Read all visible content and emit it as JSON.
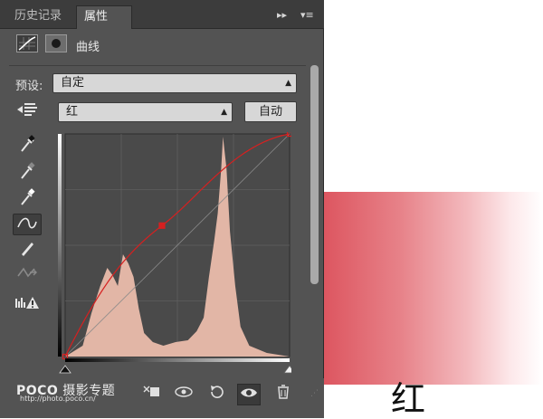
{
  "tabs": [
    {
      "label": "历史记录",
      "active": false
    },
    {
      "label": "属性",
      "active": true
    }
  ],
  "tab_controls": {
    "collapse": "▸▸",
    "menu": "▾≡"
  },
  "header": {
    "title": "曲线",
    "curve_icon": "curves-adjustment-icon",
    "mask_icon": "mask-icon"
  },
  "preset": {
    "label": "预设:",
    "value": "自定"
  },
  "channel": {
    "value": "红",
    "auto_label": "自动"
  },
  "left_tools": [
    {
      "name": "targeted-adjustment-icon",
      "glyph": "☚"
    },
    {
      "name": "black-eyedropper-icon",
      "glyph": "⁄"
    },
    {
      "name": "gray-eyedropper-icon",
      "glyph": "⁄"
    },
    {
      "name": "white-eyedropper-icon",
      "glyph": "⁄"
    },
    {
      "name": "curve-point-icon",
      "glyph": "∿"
    },
    {
      "name": "pencil-icon",
      "glyph": "✎"
    },
    {
      "name": "smooth-icon",
      "glyph": "⇝"
    },
    {
      "name": "clipping-warning-icon",
      "glyph": "⚠"
    }
  ],
  "curve": {
    "points": [
      [
        0,
        0
      ],
      [
        110,
        150
      ],
      [
        255,
        255
      ]
    ],
    "histogram_color": "#e2b6a6",
    "curve_color": "#d62020"
  },
  "bottom_toolbar": [
    "clip-to-layer-icon",
    "view-previous-icon",
    "reset-icon",
    "visibility-icon",
    "trash-icon"
  ],
  "watermark": {
    "brand": "POCO",
    "tag": "摄影专题",
    "url": "http://photo.poco.cn/"
  },
  "illustration": {
    "caption": "红",
    "gradient_start": "#dd5660",
    "gradient_end": "#ffffff"
  }
}
